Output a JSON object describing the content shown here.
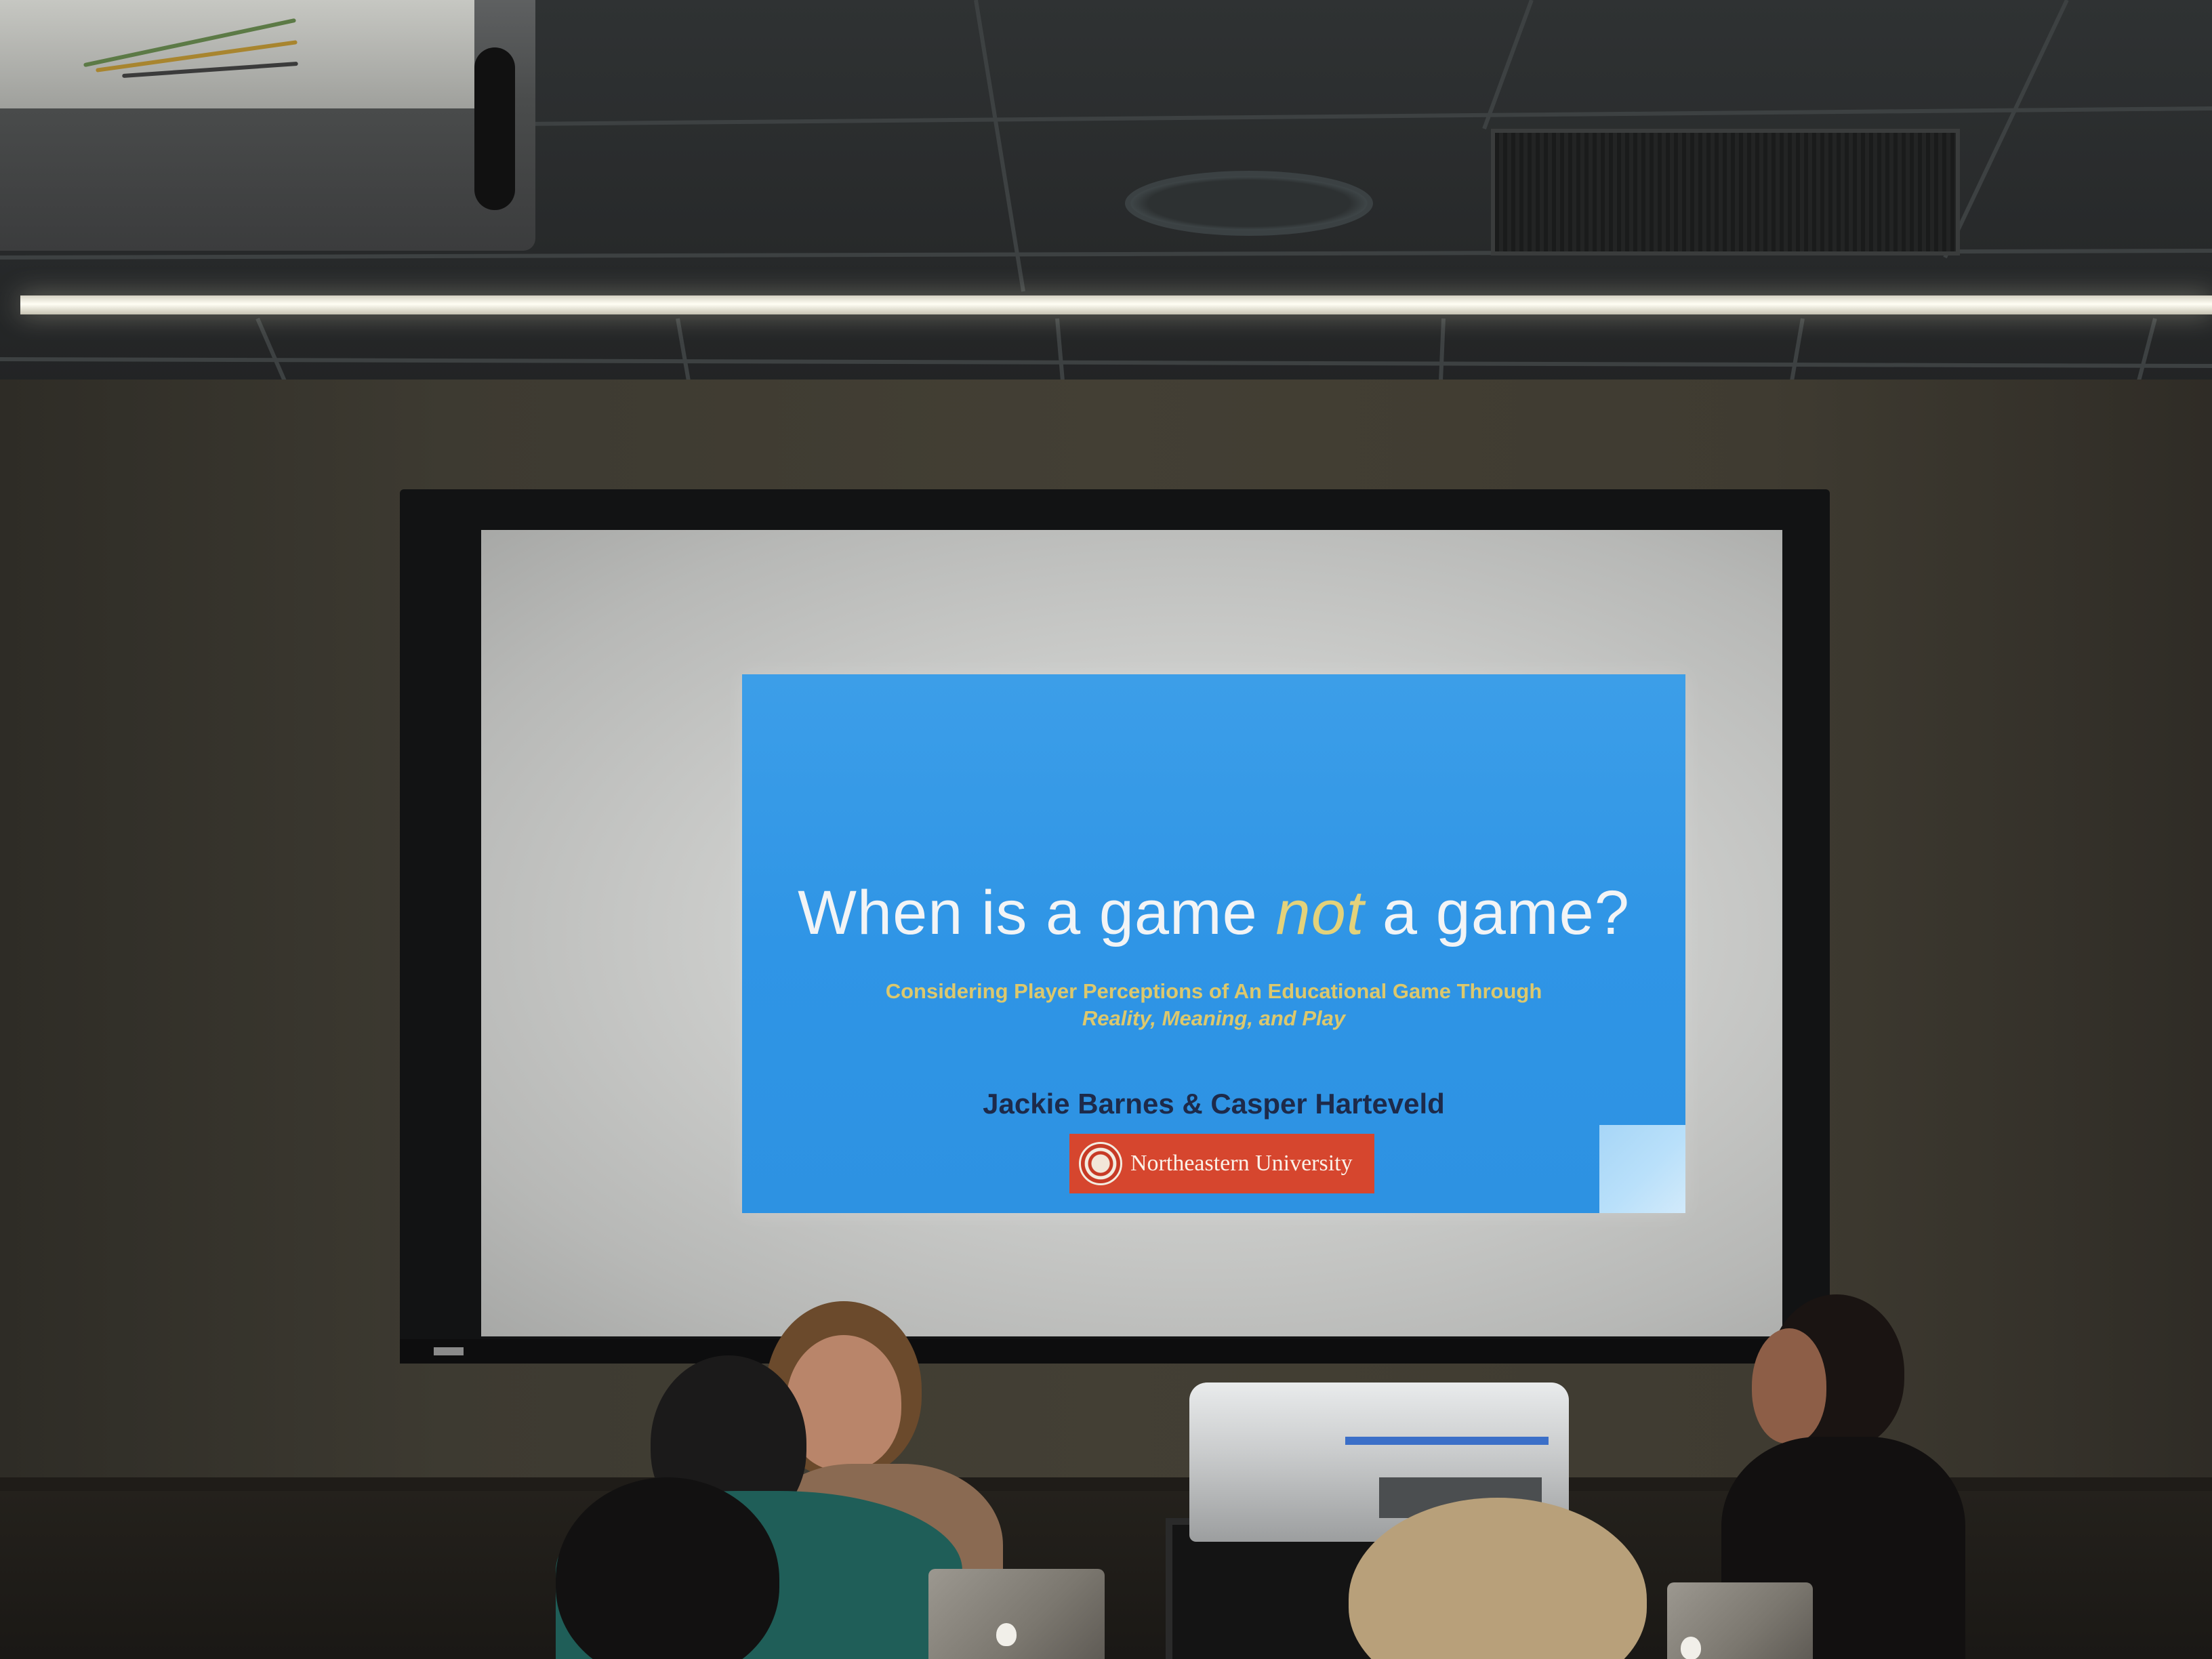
{
  "slide": {
    "title_part1": "When is a game ",
    "title_emphasis": "not",
    "title_part2": " a game?",
    "subtitle_line1": "Considering Player Perceptions of An Educational Game Through",
    "subtitle_line2": "Reality, Meaning, and Play",
    "authors": "Jackie Barnes & Casper Harteveld",
    "institution": "Northeastern University",
    "colors": {
      "background": "#2f95e6",
      "title": "#f2f4f6",
      "accent": "#e3d27a",
      "authors": "#1d2a4a",
      "logo_background": "#d6462e"
    }
  },
  "icons": {
    "logo": "university-seal-icon",
    "laptop_logo": "apple-logo-icon"
  }
}
